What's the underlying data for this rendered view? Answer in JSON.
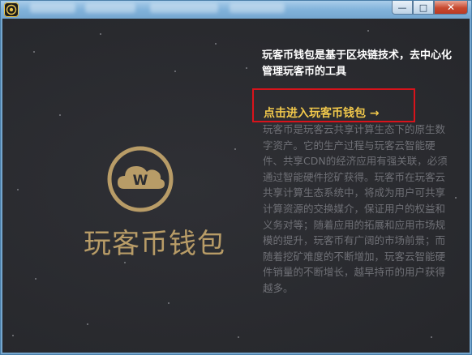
{
  "window": {
    "tabs": [
      "",
      "",
      "",
      ""
    ],
    "controls": {
      "minimize": "—",
      "maximize": "□",
      "close": "✕"
    }
  },
  "brand": {
    "logo_letter": "W",
    "name": "玩客币钱包",
    "color": "#b89c67"
  },
  "info": {
    "headline": "玩客币钱包是基于区块链技术，去中心化管理玩客币的工具",
    "cta_label": "点击进入玩客币钱包 →",
    "cta_color": "#f1c84b",
    "highlight_color": "#d8131b",
    "description": "玩客币是玩客云共享计算生态下的原生数字资产。它的生产过程与玩客云智能硬件、共享CDN的经济应用有强关联，必须通过智能硬件挖矿获得。玩客币在玩客云共享计算生态系统中，将成为用户可共享计算资源的交换媒介，保证用户的权益和义务对等；随着应用的拓展和应用市场规模的提升，玩客币有广阔的市场前景；而随着挖矿难度的不断增加，玩客云智能硬件销量的不断增长，越早持币的用户获得越多。"
  }
}
